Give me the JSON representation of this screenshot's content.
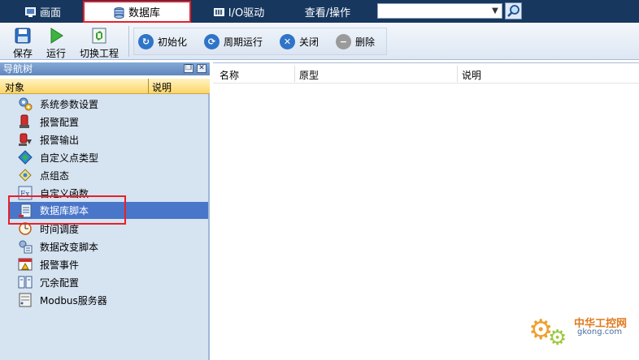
{
  "top_tabs": [
    {
      "label": "画面",
      "icon": "monitor-icon"
    },
    {
      "label": "数据库",
      "icon": "database-icon"
    },
    {
      "label": "I/O驱动",
      "icon": "io-driver-icon"
    },
    {
      "label": "查看/操作",
      "icon": ""
    }
  ],
  "search": {
    "value": "",
    "icon": "search-icon"
  },
  "toolbar": {
    "save_label": "保存",
    "run_label": "运行",
    "switch_label": "切换工程",
    "init_label": "初始化",
    "cycle_label": "周期运行",
    "close_label": "关闭",
    "delete_label": "删除"
  },
  "nav": {
    "title": "导航树",
    "col_object": "对象",
    "col_desc": "说明",
    "items": [
      {
        "label": "系统参数设置",
        "icon": "gears-icon"
      },
      {
        "label": "报警配置",
        "icon": "alarm-config-icon"
      },
      {
        "label": "报警输出",
        "icon": "alarm-output-icon"
      },
      {
        "label": "自定义点类型",
        "icon": "custom-point-type-icon"
      },
      {
        "label": "点组态",
        "icon": "point-config-icon"
      },
      {
        "label": "自定义函数",
        "icon": "function-icon"
      },
      {
        "label": "数据库脚本",
        "icon": "database-script-icon"
      },
      {
        "label": "时间调度",
        "icon": "clock-icon"
      },
      {
        "label": "数据改变脚本",
        "icon": "data-change-script-icon"
      },
      {
        "label": "报警事件",
        "icon": "alarm-event-icon"
      },
      {
        "label": "冗余配置",
        "icon": "redundancy-icon"
      },
      {
        "label": "Modbus服务器",
        "icon": "modbus-server-icon"
      }
    ],
    "selected_index": 6
  },
  "table": {
    "headers": [
      "名称",
      "原型",
      "说明"
    ]
  },
  "watermark": {
    "line1": "中华工控网",
    "line2": "gkong.com"
  },
  "colors": {
    "highlight": "#e8202a",
    "selection": "#4a76c9",
    "top_bar": "#17375e"
  }
}
